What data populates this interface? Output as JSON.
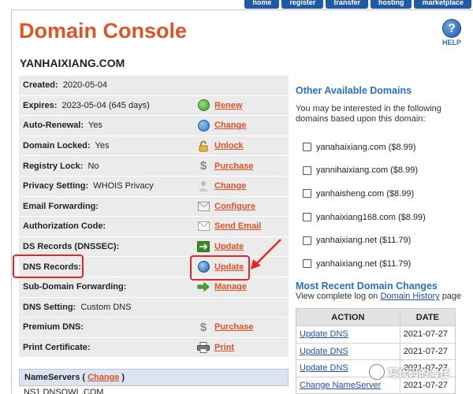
{
  "topnav": [
    "home",
    "register",
    "transfer",
    "hosting",
    "marketplace"
  ],
  "header": {
    "title": "Domain Console",
    "help_label": "HELP",
    "help_glyph": "?"
  },
  "domain": "YANHAIXIANG.COM",
  "info_rows": [
    {
      "label": "Created:",
      "value": "2020-05-04",
      "action": "",
      "icon": ""
    },
    {
      "label": "Expires:",
      "value": "2023-05-04 (645 days)",
      "action": "Renew",
      "icon": "renew-icon"
    },
    {
      "label": "Auto-Renewal:",
      "value": "Yes",
      "action": "Change",
      "icon": "clock-icon"
    },
    {
      "label": "Domain Locked:",
      "value": "Yes",
      "action": "Unlock",
      "icon": "lock-icon"
    },
    {
      "label": "Registry Lock:",
      "value": "No",
      "action": "Purchase",
      "icon": "dollar-icon"
    },
    {
      "label": "Privacy Setting:",
      "value": "WHOIS Privacy",
      "action": "Change",
      "icon": "person-icon"
    },
    {
      "label": "Email Forwarding:",
      "value": "",
      "action": "Configure",
      "icon": "envelope-icon"
    },
    {
      "label": "Authorization Code:",
      "value": "",
      "action": "Send Email",
      "icon": "envelope-send-icon"
    },
    {
      "label": "DS Records (DNSSEC):",
      "value": "",
      "action": "Update",
      "icon": "dnssec-icon"
    },
    {
      "label": "DNS Records:",
      "value": "",
      "action": "Update",
      "icon": "globe-icon"
    },
    {
      "label": "Sub-Domain Forwarding:",
      "value": "",
      "action": "Manage",
      "icon": "arrow-right-icon"
    },
    {
      "label": "DNS Setting:",
      "value": "Custom DNS",
      "action": "",
      "icon": ""
    },
    {
      "label": "Premium DNS:",
      "value": "",
      "action": "Purchase",
      "icon": "dollar-icon"
    },
    {
      "label": "Print Certificate:",
      "value": "",
      "action": "Print",
      "icon": "printer-icon"
    }
  ],
  "nameservers": {
    "label_before": "NameServers (",
    "link": "Change",
    "label_after": ")",
    "first_value": "NS1.DNSOWL.COM"
  },
  "available": {
    "title": "Other Available Domains",
    "intro": "You may be interested in the following domains based upon this domain:",
    "items": [
      "yanahaixiang.com ($8.99)",
      "yannihaixiang.com ($8.99)",
      "yanhaisheng.com ($8.99)",
      "yanhaixiang168.com ($8.99)",
      "yanhaixiang.net ($11.79)",
      "yanhaixiang.net ($11.79)"
    ]
  },
  "changes": {
    "title": "Most Recent Domain Changes",
    "log_prefix": "View complete log on",
    "log_link": "Domain History",
    "log_suffix": "page",
    "col_action": "ACTION",
    "col_date": "DATE",
    "rows": [
      {
        "action": "Update DNS",
        "date": "2021-07-27"
      },
      {
        "action": "Update DNS",
        "date": "2021-07-27"
      },
      {
        "action": "Update DNS",
        "date": "2021-07-27"
      },
      {
        "action": "Change NameServer",
        "date": "2021-07-27"
      }
    ]
  },
  "watermark": "写代码的海怪",
  "colors": {
    "title": "#e0522a",
    "link_orange": "#e0522a",
    "link_blue": "#1f4fb0",
    "heading_blue": "#2a6fc2",
    "highlight": "#e82424"
  }
}
